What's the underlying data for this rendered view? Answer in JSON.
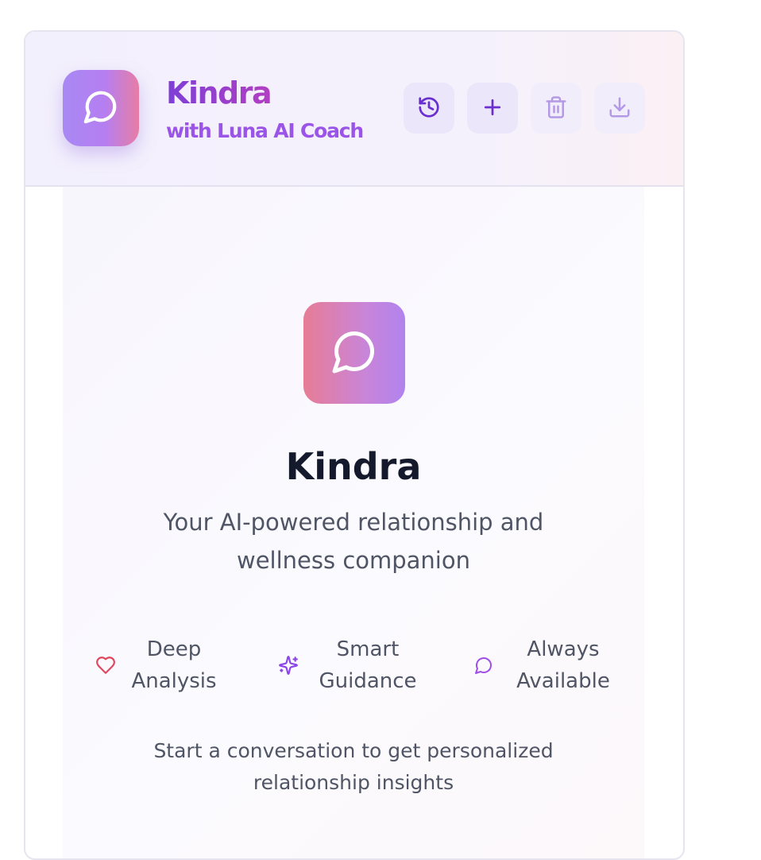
{
  "header": {
    "title": "Kindra",
    "subtitle": "with Luna AI Coach",
    "logo_icon": "chat-bubble-icon",
    "toolbar": [
      {
        "icon": "history-icon",
        "enabled": true
      },
      {
        "icon": "plus-icon",
        "enabled": true
      },
      {
        "icon": "trash-icon",
        "enabled": false
      },
      {
        "icon": "download-icon",
        "enabled": false
      }
    ]
  },
  "welcome": {
    "icon": "chat-bubble-icon",
    "title": "Kindra",
    "description": "Your AI-powered relationship and wellness companion",
    "features": [
      {
        "icon": "heart-icon",
        "label": "Deep\nAnalysis",
        "color": "#e0475f"
      },
      {
        "icon": "sparkles-icon",
        "label": "Smart\nGuidance",
        "color": "#8b45e8"
      },
      {
        "icon": "chat-bubble-icon",
        "label": "Always\nAvailable",
        "color": "#a04ee8"
      }
    ],
    "hint": "Start a conversation to get personalized relationship insights"
  },
  "colors": {
    "accent": "#8b45e8",
    "brand_gradient_start": "#a889f3",
    "brand_gradient_end": "#e77da5"
  }
}
